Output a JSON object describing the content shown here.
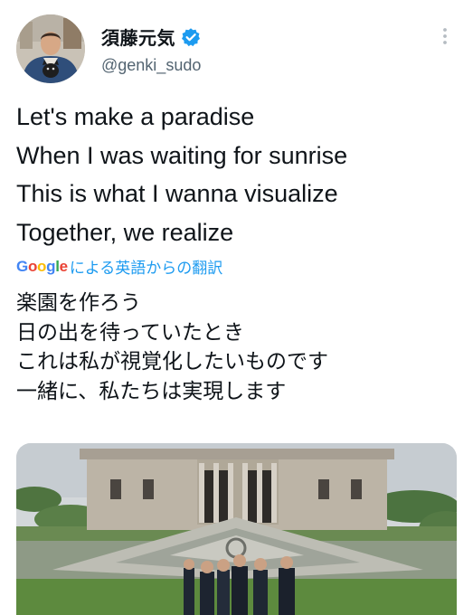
{
  "author": {
    "display_name": "須藤元気",
    "handle": "@genki_sudo",
    "verified": true,
    "verified_color": "#1d9bf0"
  },
  "icons": [
    "verified-badge-icon",
    "more-options-icon"
  ],
  "tweet": {
    "lines": [
      "Let's make a paradise",
      "When I was waiting for sunrise",
      "This is what I wanna visualize",
      "Together, we realize"
    ]
  },
  "translation": {
    "provider": "Google",
    "link_text": "による英語からの翻訳",
    "link_color": "#1d9bf0",
    "lines": [
      "楽園を作ろう",
      "日の出を待っていたとき",
      "これは私が視覚化したいものです",
      "一緒に、私たちは実現します"
    ]
  }
}
